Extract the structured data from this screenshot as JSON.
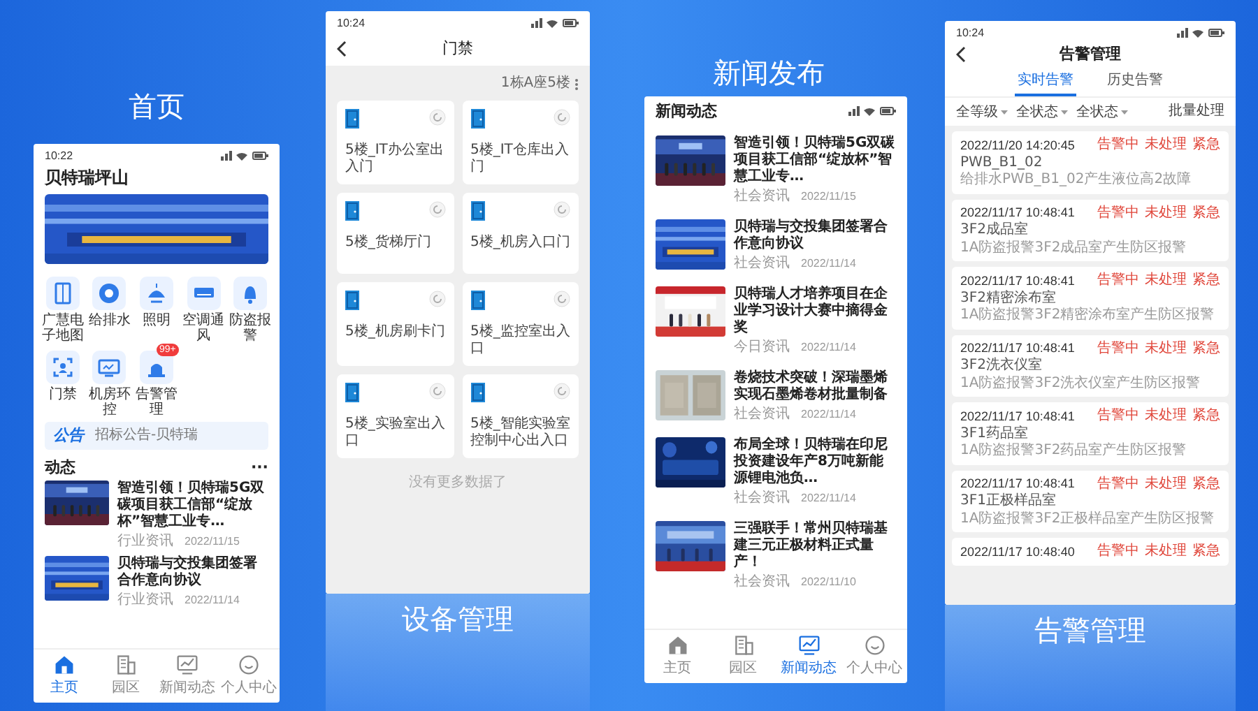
{
  "home_screen": {
    "caption": "首页",
    "status_time": "10:22",
    "title": "贝特瑞坪山",
    "functions": [
      {
        "label": "广慧电子地图"
      },
      {
        "label": "给排水"
      },
      {
        "label": "照明"
      },
      {
        "label": "空调通风"
      },
      {
        "label": "防盗报警"
      },
      {
        "label": "门禁"
      },
      {
        "label": "机房环控"
      },
      {
        "label": "告警管理",
        "badge": "99+"
      }
    ],
    "notice": {
      "tag": "公告",
      "text": "招标公告-贝特瑞"
    },
    "section": {
      "title": "动态",
      "more": "···"
    },
    "news": [
      {
        "title": "智造引领！贝特瑞5G双碳项目获工信部“绽放杯”智慧工业专…",
        "source": "行业资讯",
        "date": "2022/11/15"
      },
      {
        "title": "贝特瑞与交投集团签署合作意向协议",
        "source": "行业资讯",
        "date": "2022/11/14"
      }
    ],
    "tabs": [
      {
        "label": "主页",
        "selected": true
      },
      {
        "label": "园区",
        "selected": false
      },
      {
        "label": "新闻动态",
        "selected": false
      },
      {
        "label": "个人中心",
        "selected": false
      }
    ]
  },
  "access_screen": {
    "caption": "设备管理",
    "status_time": "10:24",
    "title": "门禁",
    "location": "1栋A座5楼",
    "doors": [
      {
        "label": "5楼_IT办公室出入门"
      },
      {
        "label": "5楼_IT仓库出入门"
      },
      {
        "label": "5楼_货梯厅门"
      },
      {
        "label": "5楼_机房入口门"
      },
      {
        "label": "5楼_机房刷卡门"
      },
      {
        "label": "5楼_监控室出入口"
      },
      {
        "label": "5楼_实验室出入口"
      },
      {
        "label": "5楼_智能实验室控制中心出入口"
      }
    ],
    "footer": "没有更多数据了"
  },
  "news_screen": {
    "caption": "新闻发布",
    "title": "新闻动态",
    "news": [
      {
        "title": "智造引领！贝特瑞5G双碳项目获工信部“绽放杯”智慧工业专…",
        "source": "社会资讯",
        "date": "2022/11/15"
      },
      {
        "title": "贝特瑞与交投集团签署合作意向协议",
        "source": "社会资讯",
        "date": "2022/11/14"
      },
      {
        "title": "贝特瑞人才培养项目在企业学习设计大赛中摘得金奖",
        "source": "今日资讯",
        "date": "2022/11/14"
      },
      {
        "title": "卷烧技术突破！深瑞墨烯实现石墨烯卷材批量制备",
        "source": "社会资讯",
        "date": "2022/11/14"
      },
      {
        "title": "布局全球！贝特瑞在印尼投资建设年产8万吨新能源锂电池负…",
        "source": "社会资讯",
        "date": "2022/11/14"
      },
      {
        "title": "三强联手！常州贝特瑞基建三元正极材料正式量产！",
        "source": "社会资讯",
        "date": "2022/11/10"
      }
    ],
    "tabs": [
      {
        "label": "主页",
        "selected": false
      },
      {
        "label": "园区",
        "selected": false
      },
      {
        "label": "新闻动态",
        "selected": true
      },
      {
        "label": "个人中心",
        "selected": false
      }
    ]
  },
  "alarm_screen": {
    "caption": "告警管理",
    "status_time": "10:24",
    "title": "告警管理",
    "tabs": [
      {
        "label": "实时告警",
        "selected": true
      },
      {
        "label": "历史告警",
        "selected": false
      }
    ],
    "filters": [
      {
        "label": "全等级"
      },
      {
        "label": "全状态"
      },
      {
        "label": "全状态"
      }
    ],
    "batch_action": "批量处理",
    "alarms": [
      {
        "time": "2022/11/20 14:20:45",
        "tags": [
          "告警中",
          "未处理",
          "紧急"
        ],
        "location": "PWB_B1_02",
        "description": "给排水PWB_B1_02产生液位高2故障"
      },
      {
        "time": "2022/11/17 10:48:41",
        "tags": [
          "告警中",
          "未处理",
          "紧急"
        ],
        "location": "3F2成品室",
        "description": "1A防盗报警3F2成品室产生防区报警"
      },
      {
        "time": "2022/11/17 10:48:41",
        "tags": [
          "告警中",
          "未处理",
          "紧急"
        ],
        "location": "3F2精密涂布室",
        "description": "1A防盗报警3F2精密涂布室产生防区报警"
      },
      {
        "time": "2022/11/17 10:48:41",
        "tags": [
          "告警中",
          "未处理",
          "紧急"
        ],
        "location": "3F2洗衣仪室",
        "description": "1A防盗报警3F2洗衣仪室产生防区报警"
      },
      {
        "time": "2022/11/17 10:48:41",
        "tags": [
          "告警中",
          "未处理",
          "紧急"
        ],
        "location": "3F1药品室",
        "description": "1A防盗报警3F2药品室产生防区报警"
      },
      {
        "time": "2022/11/17 10:48:41",
        "tags": [
          "告警中",
          "未处理",
          "紧急"
        ],
        "location": "3F1正极样品室",
        "description": "1A防盗报警3F2正极样品室产生防区报警"
      },
      {
        "time": "2022/11/17 10:48:40",
        "tags": [
          "告警中",
          "未处理",
          "紧急"
        ]
      }
    ]
  }
}
